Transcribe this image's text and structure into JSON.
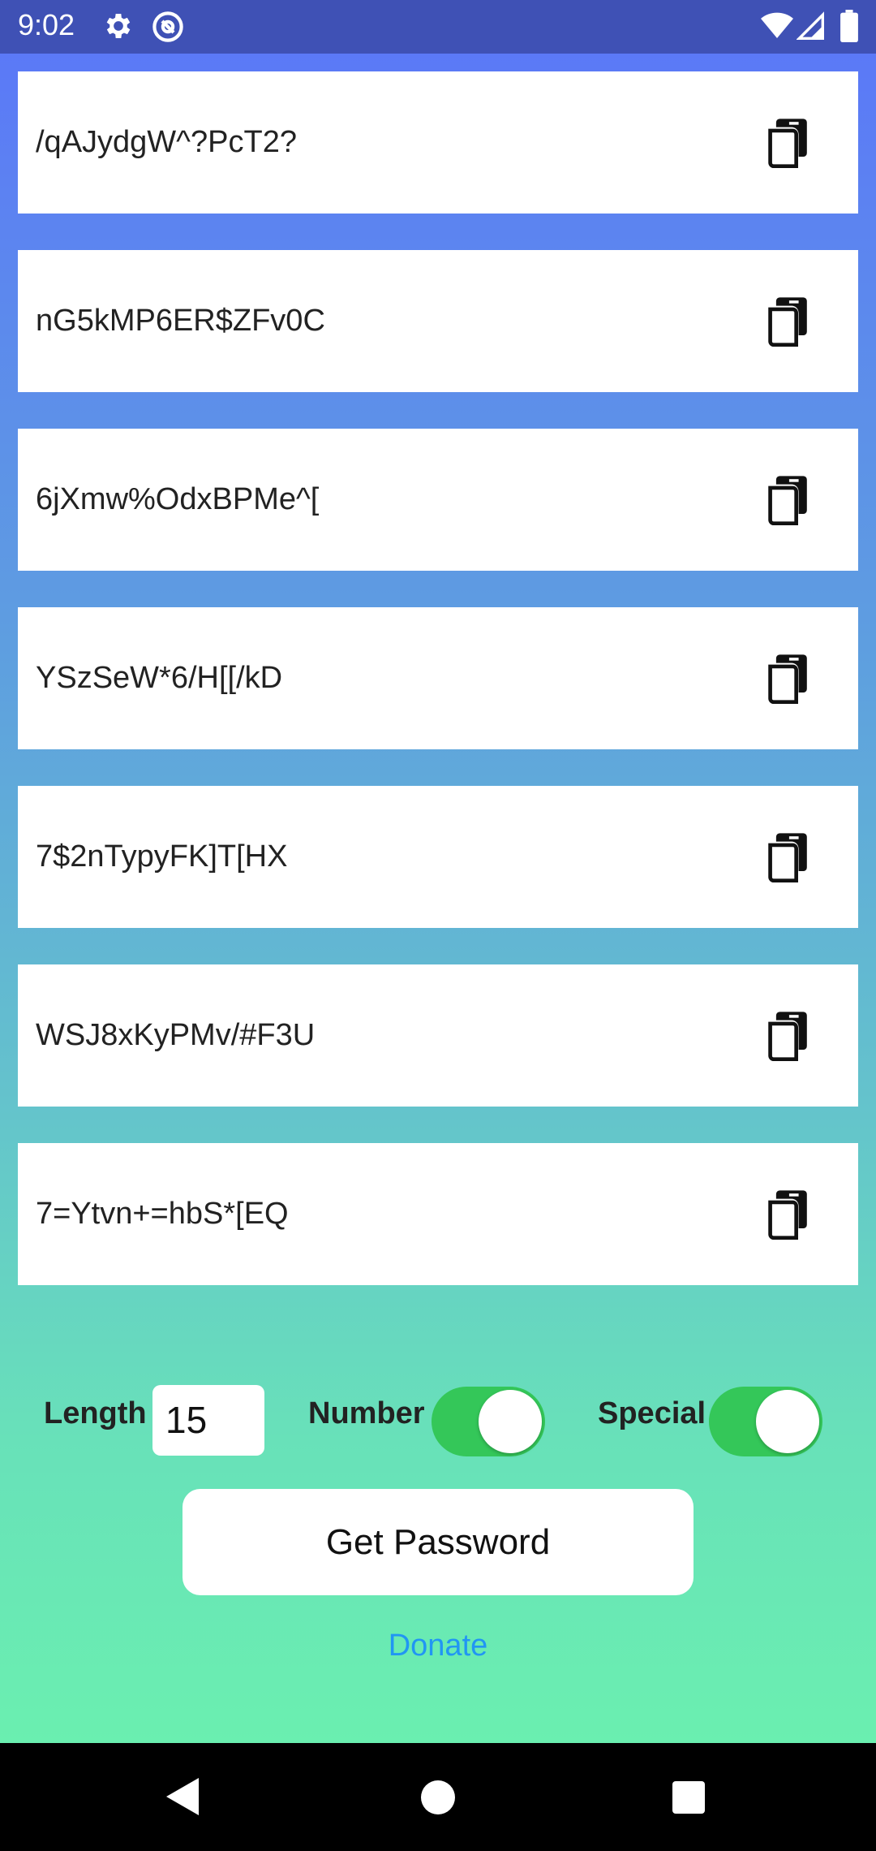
{
  "status_bar": {
    "time": "9:02",
    "icons": [
      "gear-icon",
      "at-sign-icon",
      "wifi-icon",
      "cellular-signal-icon",
      "battery-icon"
    ]
  },
  "passwords": [
    "/qAJydgW^?PcT2?",
    "nG5kMP6ER$ZFv0C",
    "6jXmw%OdxBPMe^[",
    "YSzSeW*6/H[[/kD",
    "7$2nTypyFK]T[HX",
    "WSJ8xKyPMv/#F3U",
    "7=Ytvn+=hbS*[EQ"
  ],
  "controls": {
    "length_label": "Length",
    "length_value": "15",
    "number_label": "Number",
    "number_enabled": true,
    "special_label": "Special",
    "special_enabled": true
  },
  "actions": {
    "get_password_label": "Get Password",
    "donate_label": "Donate"
  },
  "colors": {
    "status_bar": "#3f51b5",
    "gradient_top": "#5b79f7",
    "gradient_bottom": "#6aefb0",
    "toggle_on": "#34c759",
    "donate_link": "#2196f3"
  },
  "nav_bar": {
    "icons": [
      "back-icon",
      "home-icon",
      "recents-icon"
    ]
  }
}
